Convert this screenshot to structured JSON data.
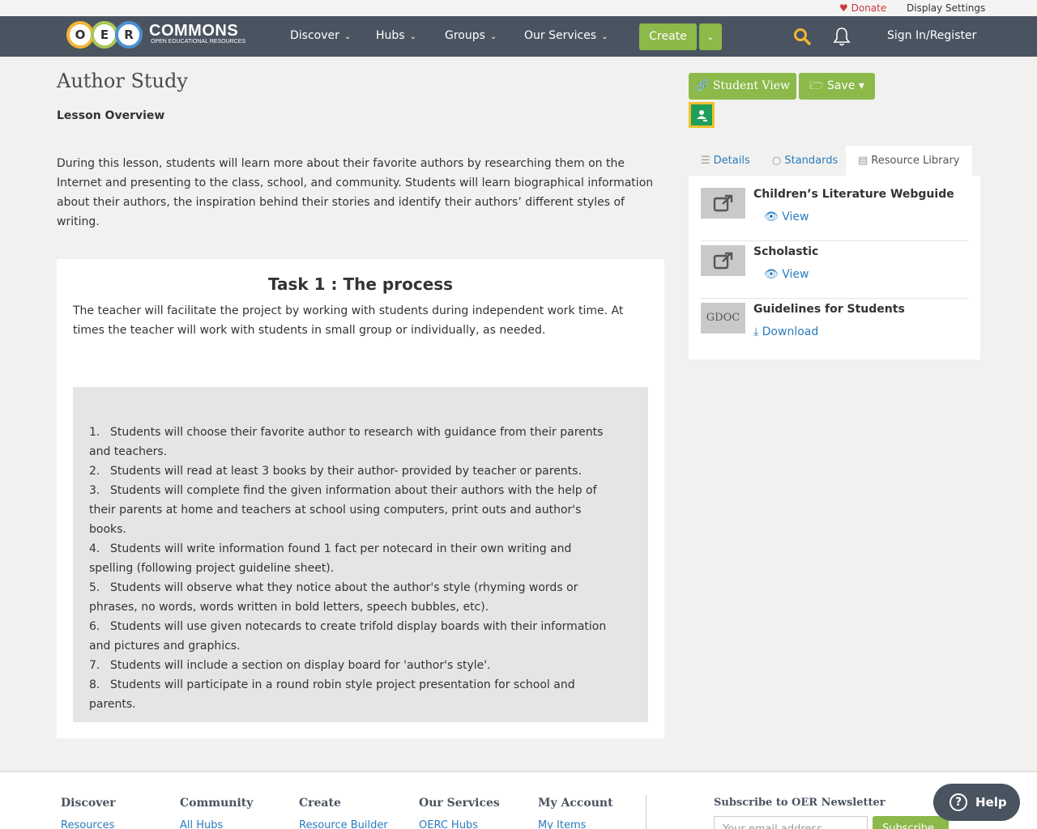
{
  "utility": {
    "donate": "Donate",
    "display_settings": "Display Settings"
  },
  "nav": {
    "logo_letters": [
      "O",
      "E",
      "R"
    ],
    "brand": "COMMONS",
    "tagline": "OPEN EDUCATIONAL RESOURCES",
    "items": [
      "Discover",
      "Hubs",
      "Groups",
      "Our Services"
    ],
    "create": "Create",
    "signin": "Sign In/Register"
  },
  "page": {
    "title": "Author Study",
    "overview_heading": "Lesson Overview",
    "overview_text": "During this lesson, students will learn more about their favorite authors by researching them on the Internet and presenting to the class, school, and community. Students will learn biographical information about their authors, the inspiration behind their stories and identify their authors’ different styles of writing."
  },
  "task": {
    "title": "Task 1 : The process",
    "description": "The teacher will facilitate the project by working with students during independent work time.  At times the teacher will work with students in small group or individually, as needed.",
    "steps": [
      {
        "num": "1.",
        "text": "Students will choose their favorite author to research with guidance from their parents and teachers."
      },
      {
        "num": "2.",
        "text": "Students will read at least 3 books by their author- provided by teacher or parents."
      },
      {
        "num": "3.",
        "text": "Students will complete find the given information about their authors with the help of their parents at home and teachers at school using computers, print outs and author's books."
      },
      {
        "num": "4.",
        "text": "Students will write information found 1 fact per notecard in their own writing and spelling (following project guideline sheet)."
      },
      {
        "num": "5.",
        "text": "Students will observe what they notice about the author's style (rhyming words or phrases, no words, words written in bold letters, speech bubbles, etc)."
      },
      {
        "num": "6.",
        "text": "Students will use given notecards to create trifold display boards with their information and pictures and graphics."
      },
      {
        "num": "7.",
        "text": "Students will include a section on display board for 'author's style'."
      },
      {
        "num": "8.",
        "text": "Students will participate in a round robin style project presentation for school and parents."
      }
    ]
  },
  "sidebar": {
    "student_view": "Student View",
    "save": "Save",
    "tabs": [
      "Details",
      "Standards",
      "Resource Library"
    ],
    "active_tab": "Resource Library",
    "resources": [
      {
        "name": "Children’s Literature Webguide",
        "thumb": "external-link-icon",
        "action": "View"
      },
      {
        "name": "Scholastic",
        "thumb": "external-link-icon",
        "action": "View"
      },
      {
        "name": "Guidelines for Students",
        "thumb_label": "GDOC",
        "action": "Download"
      }
    ]
  },
  "footer": {
    "columns": [
      {
        "heading": "Discover",
        "link": "Resources"
      },
      {
        "heading": "Community",
        "link": "All Hubs"
      },
      {
        "heading": "Create",
        "link": "Resource Builder"
      },
      {
        "heading": "Our Services",
        "link": "OERC Hubs"
      },
      {
        "heading": "My Account",
        "link": "My Items"
      }
    ],
    "newsletter_heading": "Subscribe to OER Newsletter",
    "email_placeholder": "Your email address",
    "subscribe_button": "Subscribe"
  },
  "help": "Help",
  "colors": {
    "nav_bg": "#4a5360",
    "accent_green": "#8cb94a",
    "link_blue": "#2a7bbd",
    "donate_red": "#c8383a",
    "search_gold": "#f3b435"
  }
}
